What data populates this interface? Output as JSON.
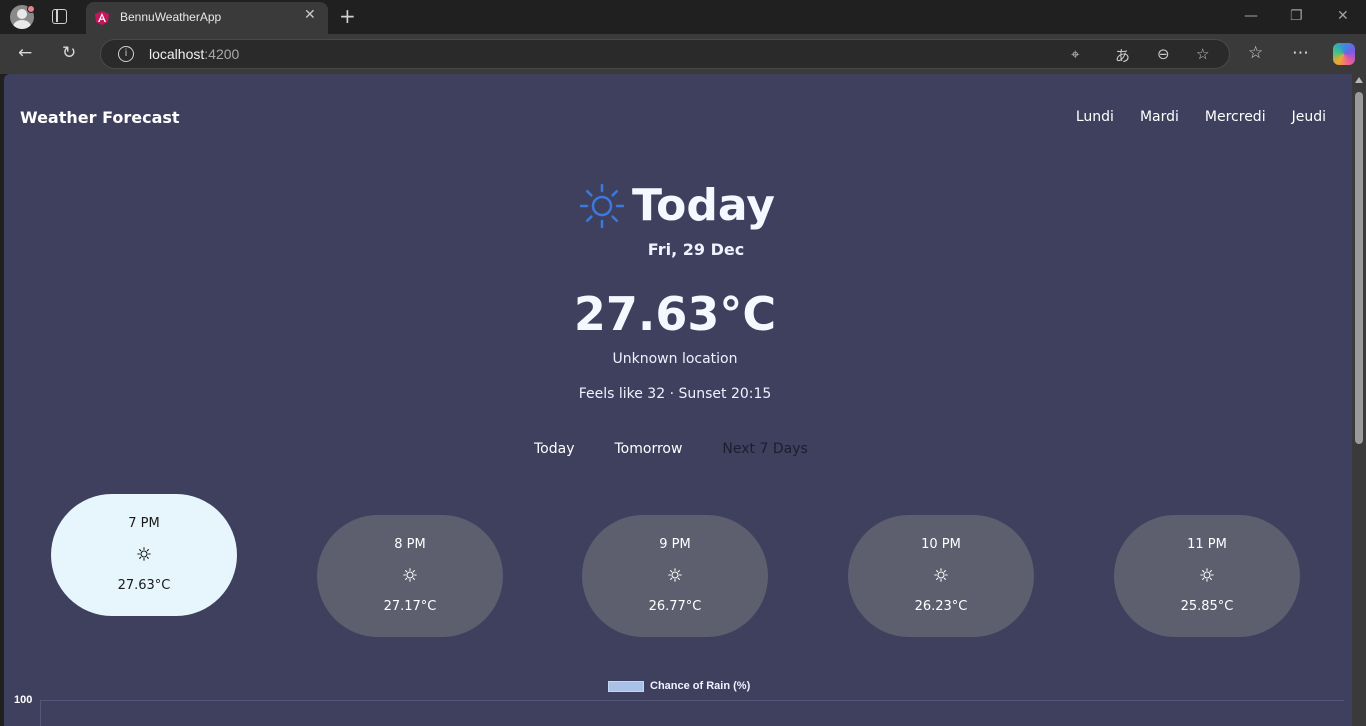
{
  "browser": {
    "tab_title": "BennuWeatherApp",
    "url_host": "localhost",
    "url_port": ":4200"
  },
  "app": {
    "brand": "Weather Forecast",
    "nav": [
      "Lundi",
      "Mardi",
      "Mercredi",
      "Jeudi"
    ]
  },
  "current": {
    "title": "Today",
    "date": "Fri, 29 Dec",
    "temperature": "27.63°C",
    "location": "Unknown location",
    "details": "Feels like 32 · Sunset 20:15"
  },
  "period_tabs": [
    {
      "label": "Today",
      "selected": true
    },
    {
      "label": "Tomorrow",
      "selected": false
    },
    {
      "label": "Next 7 Days",
      "selected": false
    }
  ],
  "hourly": [
    {
      "time": "7 PM",
      "temp": "27.63°C",
      "icon": "sun-icon",
      "active": true
    },
    {
      "time": "8 PM",
      "temp": "27.17°C",
      "icon": "sun-icon",
      "active": false
    },
    {
      "time": "9 PM",
      "temp": "26.77°C",
      "icon": "sun-icon",
      "active": false
    },
    {
      "time": "10 PM",
      "temp": "26.23°C",
      "icon": "sun-icon",
      "active": false
    },
    {
      "time": "11 PM",
      "temp": "25.85°C",
      "icon": "sun-icon",
      "active": false
    }
  ],
  "chart_data": {
    "type": "bar",
    "series": [
      {
        "name": "Chance of Rain (%)",
        "values": []
      }
    ],
    "y_ticks_visible": [
      "100"
    ],
    "legend_position": "top-center"
  },
  "colors": {
    "page_bg": "#3e405e",
    "card_bg": "#5d5f6e",
    "card_active_bg": "#e6f6fc",
    "sun_accent": "#3c78e0",
    "legend_swatch": "#a9c1e6"
  }
}
